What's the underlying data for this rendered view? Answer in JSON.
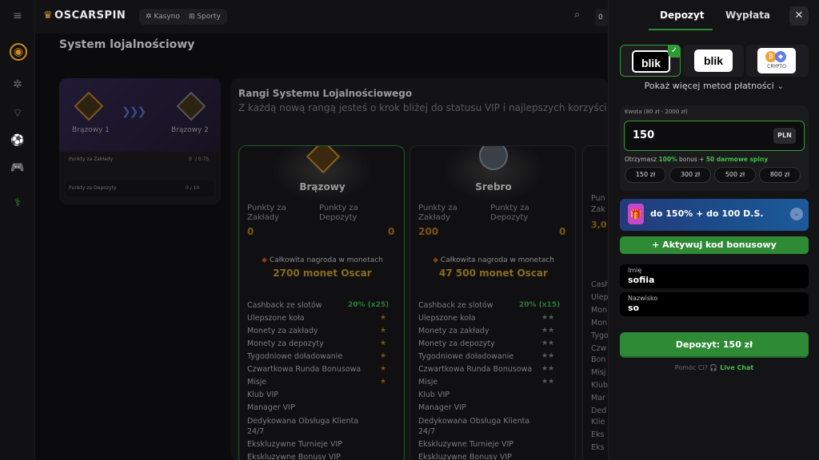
{
  "topbar": {
    "logo": "OSCARSPIN",
    "nav": [
      "Kasyno",
      "Sporty"
    ],
    "balance": "0"
  },
  "main": {
    "title": "System lojalnościowy",
    "left_card": {
      "rank_current": "Brązowy 1",
      "rank_next": "Brązowy 2",
      "row1_label": "Punkty za Zakłady",
      "row1_value": "0",
      "row1_target": "/ 0.75",
      "row2_label": "Punkty za Depozyty",
      "row2_value": "0 / 10"
    },
    "ranks": {
      "title": "Rangi Systemu Lojalnościowego",
      "subtitle": "Z każdą nową rangą jesteś o krok bliżej do statusu VIP i najlepszych korzyści!",
      "points_bets_label": "Punkty za Zakłady",
      "points_deposits_label": "Punkty za Depozyty",
      "total_reward_label": "Całkowita nagroda w monetach",
      "features": [
        "Cashback ze slotów",
        "Ulepszone koła",
        "Monety za zakłady",
        "Monety za depozyty",
        "Tygodniowe doładowanie",
        "Czwartkowa Runda Bonusowa",
        "Misje",
        "Klub VIP",
        "Manager VIP",
        "Dedykowana Obsługa Klienta 24/7",
        "Ekskluzywne Turnieje VIP",
        "Ekskluzywne Bonusy VIP"
      ],
      "cards": [
        {
          "name": "Brązowy",
          "bets": "0",
          "deposits": "0",
          "reward": "2700 monet Oscar",
          "cashback": "20% (x25)"
        },
        {
          "name": "Srebro",
          "bets": "200",
          "deposits": "0",
          "reward": "47 500 monet Oscar",
          "cashback": "20% (x15)"
        }
      ],
      "third_card_fragments": [
        "Pun",
        "Zak",
        "3,0",
        "Cash",
        "Ulep",
        "Mon",
        "Mon",
        "Tygo",
        "Czw",
        "Bon",
        "Misj",
        "Klub",
        "Mar",
        "Ded",
        "Klie",
        "Eks",
        "Eks"
      ]
    }
  },
  "panel": {
    "tab_deposit": "Depozyt",
    "tab_withdraw": "Wypłata",
    "methods": [
      "blik",
      "blik",
      "CRYPTO"
    ],
    "more_methods": "Pokaż więcej metod płatności",
    "amount_label": "Kwota (80 zł - 2000 zł)",
    "amount_value": "150",
    "currency": "PLN",
    "bonus_prefix": "Otrzymasz ",
    "bonus_pct": "100%",
    "bonus_mid": " bonus + ",
    "bonus_spins": "50 darmowe spiny",
    "quick_amounts": [
      "150 zł",
      "300 zł",
      "500 zł",
      "800 zł"
    ],
    "banner_text": "do 150% + do 100 D.S.",
    "activate_code": "+ Aktywuj kod bonusowy",
    "first_name_label": "Imię",
    "first_name_value": "sofiia",
    "last_name_label": "Nazwisko",
    "last_name_value": "so",
    "deposit_button": "Depozyt: 150 zł",
    "help_text": "Pomóc Ci?",
    "live_chat": "Live Chat"
  }
}
